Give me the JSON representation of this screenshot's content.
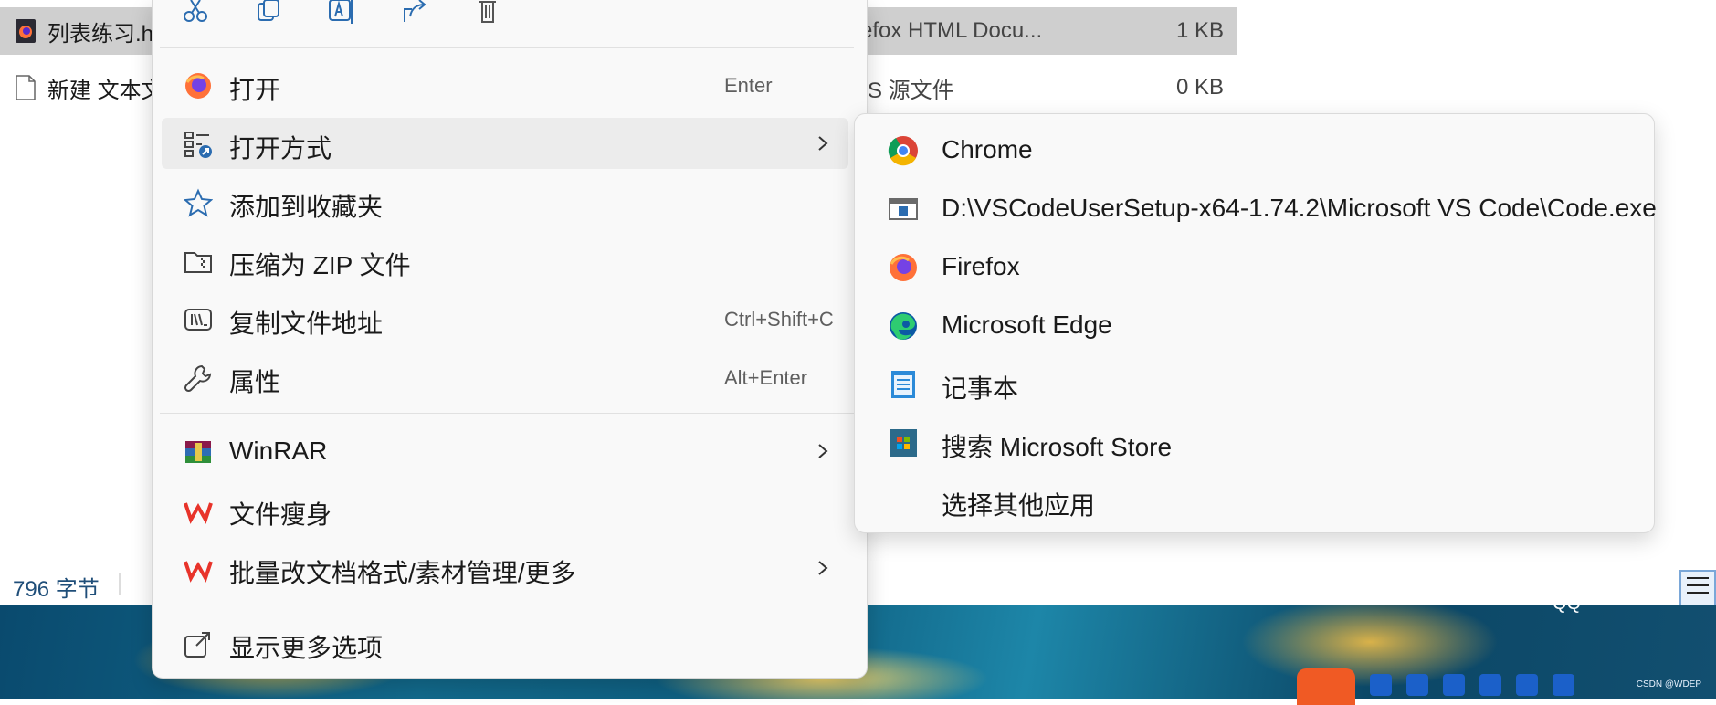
{
  "explorer": {
    "files": [
      {
        "name": "列表练习.h",
        "type": "Firefox HTML Docu...",
        "type_visible": "refox HTML Docu...",
        "size": "1 KB",
        "selected": true
      },
      {
        "name": "新建 文本文",
        "type_visible": "SS 源文件",
        "size": "0 KB",
        "selected": false
      }
    ],
    "status": {
      "byte_count": "796 字节"
    }
  },
  "context_menu": {
    "quick_actions": [
      "cut-icon",
      "copy-icon",
      "rename-icon",
      "share-icon",
      "delete-icon"
    ],
    "items": [
      {
        "label": "打开",
        "shortcut": "Enter",
        "icon": "firefox-icon"
      },
      {
        "label": "打开方式",
        "icon": "open-with-icon",
        "has_submenu": true
      },
      {
        "label": "添加到收藏夹",
        "icon": "star-icon"
      },
      {
        "label": "压缩为 ZIP 文件",
        "icon": "zip-folder-icon"
      },
      {
        "label": "复制文件地址",
        "shortcut": "Ctrl+Shift+C",
        "icon": "copy-path-icon"
      },
      {
        "label": "属性",
        "shortcut": "Alt+Enter",
        "icon": "wrench-icon"
      },
      {
        "label": "WinRAR",
        "icon": "winrar-icon",
        "has_submenu": true
      },
      {
        "label": "文件瘦身",
        "icon": "wps-icon"
      },
      {
        "label": "批量改文档格式/素材管理/更多",
        "icon": "wps-icon",
        "has_submenu": true
      },
      {
        "label": "显示更多选项",
        "icon": "more-options-icon"
      }
    ]
  },
  "submenu": {
    "items": [
      {
        "label": "Chrome",
        "icon": "chrome-icon"
      },
      {
        "label": "D:\\VSCodeUserSetup-x64-1.74.2\\Microsoft VS Code\\Code.exe",
        "icon": "exe-icon"
      },
      {
        "label": "Firefox",
        "icon": "firefox-icon"
      },
      {
        "label": "Microsoft Edge",
        "icon": "edge-icon"
      },
      {
        "label": "记事本",
        "icon": "notepad-icon"
      },
      {
        "label": "搜索 Microsoft Store",
        "icon": "store-icon"
      },
      {
        "label": "选择其他应用",
        "icon": ""
      }
    ]
  },
  "desktop": {
    "qq_label": "QQ",
    "watermark": "CSDN @WDEP"
  },
  "colors": {
    "menu_bg": "#f9f9f9",
    "hover": "#ececec",
    "selected_row": "#cfcfcf",
    "wps_red": "#e8332a"
  }
}
